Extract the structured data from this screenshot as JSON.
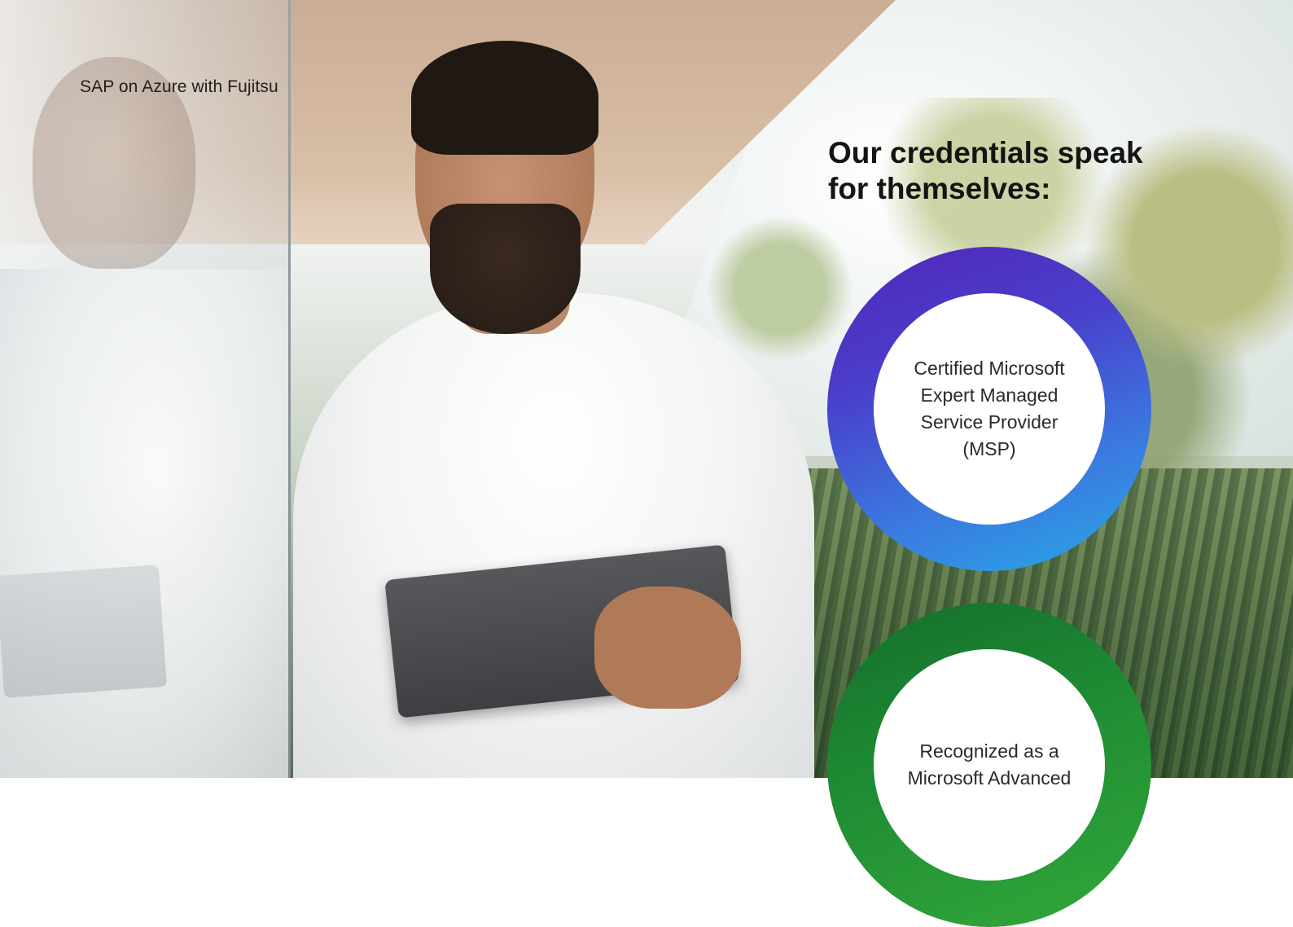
{
  "header": {
    "breadcrumb": "SAP on Azure with Fujitsu"
  },
  "main": {
    "heading": "Our credentials speak for themselves:",
    "credentials": [
      {
        "label": "Certified Microsoft Expert Managed Service Provider (MSP)",
        "ring_color": "#4a3fcb"
      },
      {
        "label": "Recognized as a Microsoft Advanced",
        "ring_color": "#1d8a33"
      }
    ]
  },
  "hero_image": {
    "icon": "person-with-tablet-photo"
  }
}
